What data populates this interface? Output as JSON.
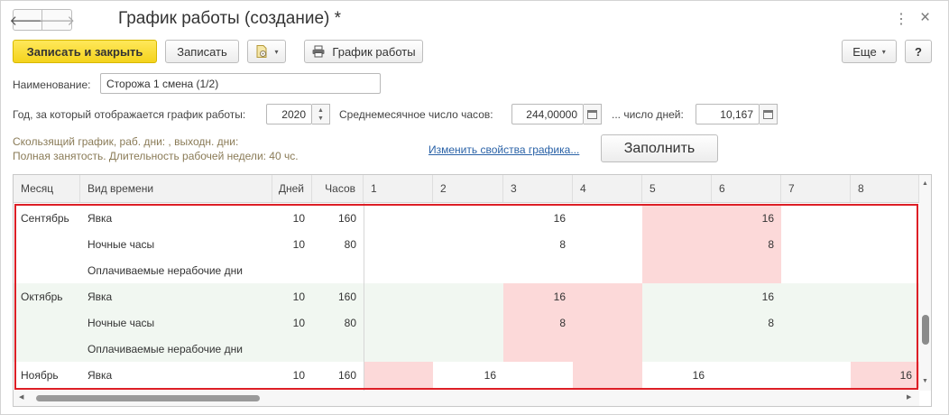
{
  "window": {
    "title": "График работы (создание) *",
    "back_glyph": "🡐",
    "forward_glyph": "🡒",
    "more_glyph": "⋮",
    "close_glyph": "×"
  },
  "toolbar": {
    "save_close_label": "Записать и закрыть",
    "save_label": "Записать",
    "doc_dropdown_glyph": "▾",
    "schedule_label": "График работы",
    "more_label": "Еще",
    "more_dropdown_glyph": "▾",
    "help_label": "?"
  },
  "form": {
    "name_label": "Наименование:",
    "name_value": "Сторожа 1 смена (1/2)",
    "year_label": "Год, за который отображается график работы:",
    "year_value": "2020",
    "avg_hours_label": "Среднемесячное число часов:",
    "avg_hours_value": "244,00000",
    "days_label": "... число дней:",
    "days_value": "10,167",
    "note_line1": "Скользящий график, раб. дни: , выходн. дни:",
    "note_line2": "Полная занятость. Длительность рабочей недели: 40 чс.",
    "change_link": "Изменить свойства графика...",
    "fill_label": "Заполнить"
  },
  "table": {
    "columns": [
      "Месяц",
      "Вид времени",
      "Дней",
      "Часов",
      "1",
      "2",
      "3",
      "4",
      "5",
      "6",
      "7",
      "8"
    ],
    "rows": [
      {
        "month": "Сентябрь",
        "kind": "Явка",
        "days": "10",
        "hours": "160",
        "d": [
          "",
          "",
          "16",
          "",
          "",
          "16",
          "",
          ""
        ]
      },
      {
        "month": "",
        "kind": "Ночные часы",
        "days": "10",
        "hours": "80",
        "d": [
          "",
          "",
          "8",
          "",
          "",
          "8",
          "",
          ""
        ]
      },
      {
        "month": "",
        "kind": "Оплачиваемые нерабочие дни",
        "days": "",
        "hours": "",
        "d": [
          "",
          "",
          "",
          "",
          "",
          "",
          "",
          ""
        ]
      },
      {
        "month": "Октябрь",
        "kind": "Явка",
        "days": "10",
        "hours": "160",
        "d": [
          "",
          "",
          "16",
          "",
          "",
          "16",
          "",
          ""
        ]
      },
      {
        "month": "",
        "kind": "Ночные часы",
        "days": "10",
        "hours": "80",
        "d": [
          "",
          "",
          "8",
          "",
          "",
          "8",
          "",
          ""
        ]
      },
      {
        "month": "",
        "kind": "Оплачиваемые нерабочие дни",
        "days": "",
        "hours": "",
        "d": [
          "",
          "",
          "",
          "",
          "",
          "",
          "",
          ""
        ]
      },
      {
        "month": "Ноябрь",
        "kind": "Явка",
        "days": "10",
        "hours": "160",
        "d": [
          "",
          "16",
          "",
          "",
          "16",
          "",
          "",
          "16"
        ]
      }
    ]
  },
  "colors": {
    "primary_button": "#f4d31d",
    "weekend_cell": "#fcd9d9",
    "october_row": "#f1f7f1",
    "highlight_frame": "#dd1f26",
    "link": "#2a62a7"
  }
}
